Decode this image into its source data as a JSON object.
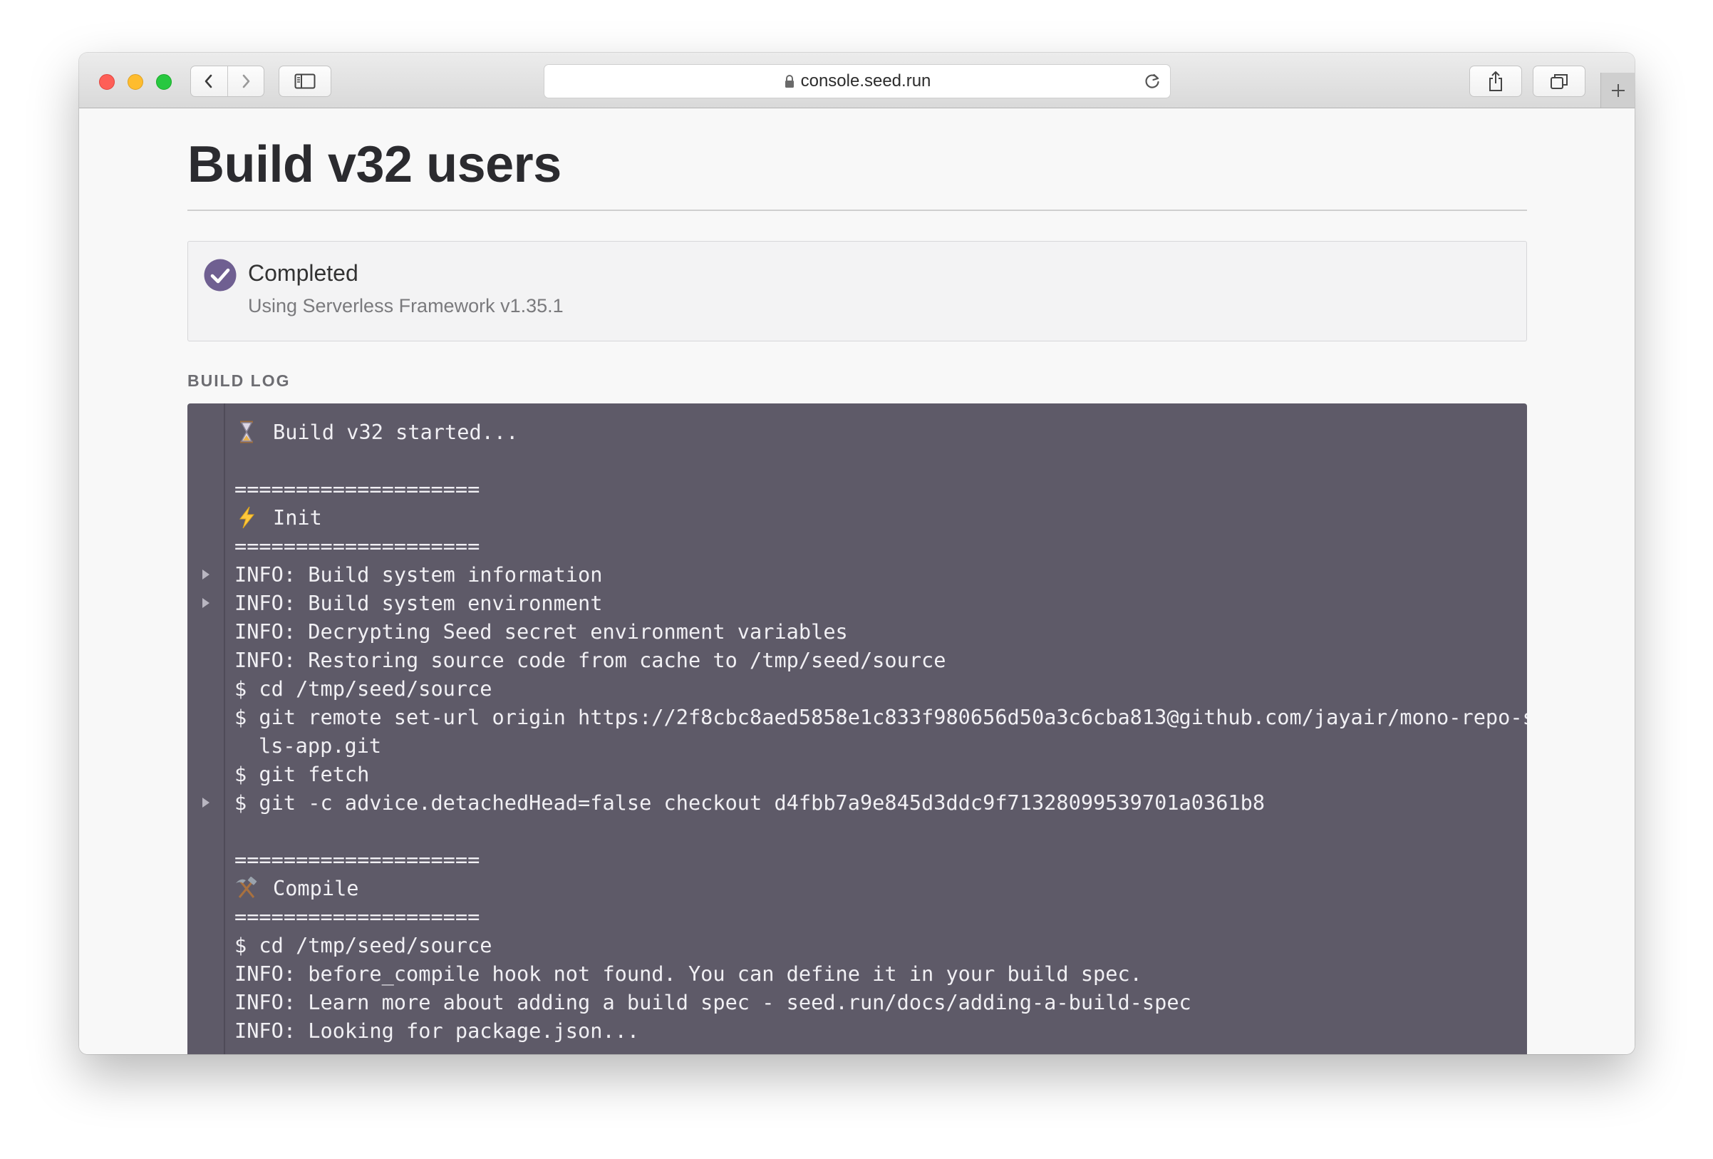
{
  "browser": {
    "url": "console.seed.run",
    "icons": {
      "back": "chevron-left-icon",
      "forward": "chevron-right-icon",
      "sidebar": "sidebar-icon",
      "lock": "lock-icon",
      "reload": "reload-icon",
      "share": "share-icon",
      "tabs": "tabs-icon",
      "new_tab": "plus-icon"
    }
  },
  "page": {
    "title": "Build v32 users"
  },
  "status": {
    "title": "Completed",
    "subtitle": "Using Serverless Framework v1.35.1",
    "color": "#6f5f91",
    "icon": "check-circle-icon"
  },
  "build_log": {
    "label": "BUILD LOG",
    "background": "#5e5a68",
    "lines": [
      {
        "icon": "hourglass-icon",
        "text": "Build v32 started..."
      },
      {
        "text": ""
      },
      {
        "text": "===================="
      },
      {
        "icon": "lightning-icon",
        "text": "Init"
      },
      {
        "text": "===================="
      },
      {
        "text": "INFO: Build system information",
        "expandable": true
      },
      {
        "text": "INFO: Build system environment",
        "expandable": true
      },
      {
        "text": "INFO: Decrypting Seed secret environment variables"
      },
      {
        "text": "INFO: Restoring source code from cache to /tmp/seed/source"
      },
      {
        "text": "$ cd /tmp/seed/source"
      },
      {
        "text": "$ git remote set-url origin https://2f8cbc8aed5858e1c833f980656d50a3c6cba813@github.com/jayair/mono-repo-s",
        "cont": "ls-app.git"
      },
      {
        "text": "$ git fetch"
      },
      {
        "text": "$ git -c advice.detachedHead=false checkout d4fbb7a9e845d3ddc9f71328099539701a0361b8",
        "expandable": true
      },
      {
        "text": ""
      },
      {
        "text": "===================="
      },
      {
        "icon": "hammer-pick-icon",
        "text": "Compile"
      },
      {
        "text": "===================="
      },
      {
        "text": "$ cd /tmp/seed/source"
      },
      {
        "text": "INFO: before_compile hook not found. You can define it in your build spec."
      },
      {
        "text": "INFO: Learn more about adding a build spec - seed.run/docs/adding-a-build-spec"
      },
      {
        "text": "INFO: Looking for package.json..."
      }
    ]
  }
}
